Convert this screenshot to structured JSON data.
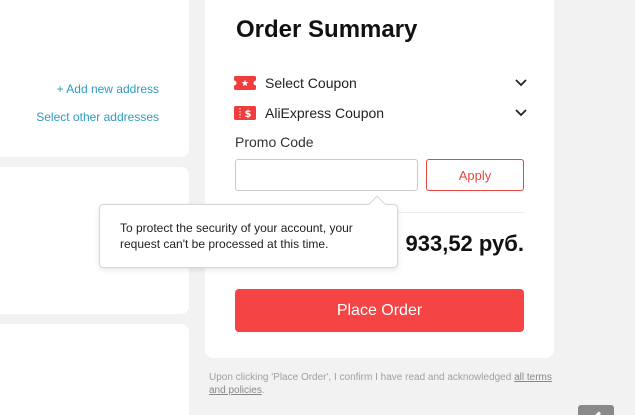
{
  "address": {
    "add_new_label": "+ Add new address",
    "select_other_label": "Select other addresses"
  },
  "summary": {
    "title": "Order Summary",
    "coupons": [
      {
        "label": "Select Coupon",
        "icon": "coupon-ticket-icon"
      },
      {
        "label": "AliExpress Coupon",
        "icon": "coupon-dollar-icon"
      }
    ],
    "promo_label": "Promo Code",
    "promo_value": "",
    "promo_placeholder": "",
    "apply_label": "Apply",
    "total_visible": "933,52 руб.",
    "place_order_label": "Place Order"
  },
  "tooltip": {
    "message": "To protect the security of your account, your request can't be processed at this time."
  },
  "disclaimer": {
    "text": "Upon clicking 'Place Order', I confirm I have read and acknowledged ",
    "link": "all terms and policies",
    "end": "."
  },
  "colors": {
    "accent_red": "#f44444",
    "link_blue": "#2e9cc3",
    "coupon_red": "#f03c3c"
  }
}
